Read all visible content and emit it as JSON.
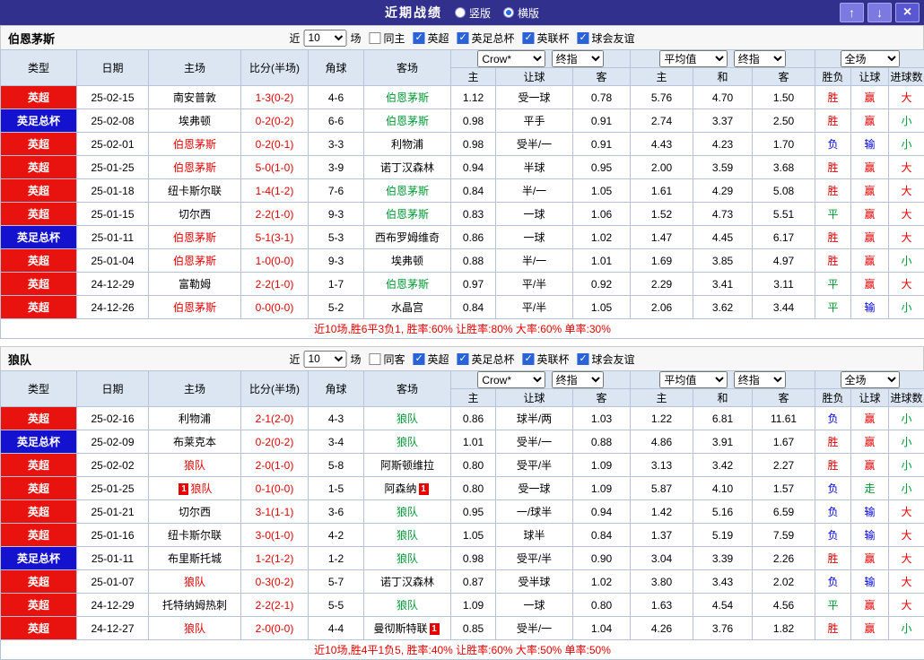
{
  "topbar": {
    "title": "近期战绩",
    "radios": [
      {
        "label": "竖版",
        "checked": false
      },
      {
        "label": "横版",
        "checked": true
      }
    ],
    "up_button": "↑",
    "down_button": "↓",
    "close_button": "×"
  },
  "table_header": {
    "type": "类型",
    "date": "日期",
    "home": "主场",
    "score": "比分(半场)",
    "corner": "角球",
    "away": "客场",
    "odds_source": "Crow*",
    "final_odds": "终指",
    "average": "平均值",
    "scope": "全场",
    "home_odds": "主",
    "handicap": "让球",
    "away_odds": "客",
    "avg_home": "主",
    "avg_draw": "和",
    "avg_away": "客",
    "win_draw_lose": "胜负",
    "handicap_result": "让球",
    "goals_result": "进球数"
  },
  "colors": {
    "league_red": "#e8120e",
    "league_blue": "#1412cf",
    "win_red": "#e60000",
    "draw_green": "#009933",
    "lose_blue": "#0000e6"
  },
  "sections": [
    {
      "team": "伯恩茅斯",
      "filters": {
        "near": "近",
        "count": "10",
        "games": "场",
        "same": {
          "label": "同主",
          "checked": false
        },
        "leagues": [
          {
            "label": "英超",
            "checked": true
          },
          {
            "label": "英足总杯",
            "checked": true
          },
          {
            "label": "英联杯",
            "checked": true
          },
          {
            "label": "球会友谊",
            "checked": true
          }
        ]
      },
      "rows": [
        {
          "league": "英超",
          "lcls": "red",
          "date": "25-02-15",
          "home": "南安普敦",
          "hcls": "",
          "hcard": "",
          "score": "1-3(0-2)",
          "corner": "4-6",
          "away": "伯恩茅斯",
          "acls": "green",
          "acard": "",
          "odds": [
            "1.12",
            "受一球",
            "0.78",
            "5.76",
            "4.70",
            "1.50"
          ],
          "res": [
            [
              "胜",
              "red"
            ],
            [
              "赢",
              "red"
            ],
            [
              "大",
              "red"
            ]
          ]
        },
        {
          "league": "英足总杯",
          "lcls": "blue",
          "date": "25-02-08",
          "home": "埃弗顿",
          "hcls": "",
          "hcard": "",
          "score": "0-2(0-2)",
          "corner": "6-6",
          "away": "伯恩茅斯",
          "acls": "green",
          "acard": "",
          "odds": [
            "0.98",
            "平手",
            "0.91",
            "2.74",
            "3.37",
            "2.50"
          ],
          "res": [
            [
              "胜",
              "red"
            ],
            [
              "赢",
              "red"
            ],
            [
              "小",
              "green"
            ]
          ]
        },
        {
          "league": "英超",
          "lcls": "red",
          "date": "25-02-01",
          "home": "伯恩茅斯",
          "hcls": "red",
          "hcard": "",
          "score": "0-2(0-1)",
          "corner": "3-3",
          "away": "利物浦",
          "acls": "",
          "acard": "",
          "odds": [
            "0.98",
            "受半/一",
            "0.91",
            "4.43",
            "4.23",
            "1.70"
          ],
          "res": [
            [
              "负",
              "blue"
            ],
            [
              "输",
              "blue"
            ],
            [
              "小",
              "green"
            ]
          ]
        },
        {
          "league": "英超",
          "lcls": "red",
          "date": "25-01-25",
          "home": "伯恩茅斯",
          "hcls": "red",
          "hcard": "",
          "score": "5-0(1-0)",
          "corner": "3-9",
          "away": "诺丁汉森林",
          "acls": "",
          "acard": "",
          "odds": [
            "0.94",
            "半球",
            "0.95",
            "2.00",
            "3.59",
            "3.68"
          ],
          "res": [
            [
              "胜",
              "red"
            ],
            [
              "赢",
              "red"
            ],
            [
              "大",
              "red"
            ]
          ]
        },
        {
          "league": "英超",
          "lcls": "red",
          "date": "25-01-18",
          "home": "纽卡斯尔联",
          "hcls": "",
          "hcard": "",
          "score": "1-4(1-2)",
          "corner": "7-6",
          "away": "伯恩茅斯",
          "acls": "green",
          "acard": "",
          "odds": [
            "0.84",
            "半/一",
            "1.05",
            "1.61",
            "4.29",
            "5.08"
          ],
          "res": [
            [
              "胜",
              "red"
            ],
            [
              "赢",
              "red"
            ],
            [
              "大",
              "red"
            ]
          ]
        },
        {
          "league": "英超",
          "lcls": "red",
          "date": "25-01-15",
          "home": "切尔西",
          "hcls": "",
          "hcard": "",
          "score": "2-2(1-0)",
          "corner": "9-3",
          "away": "伯恩茅斯",
          "acls": "green",
          "acard": "",
          "odds": [
            "0.83",
            "一球",
            "1.06",
            "1.52",
            "4.73",
            "5.51"
          ],
          "res": [
            [
              "平",
              "green"
            ],
            [
              "赢",
              "red"
            ],
            [
              "大",
              "red"
            ]
          ]
        },
        {
          "league": "英足总杯",
          "lcls": "blue",
          "date": "25-01-11",
          "home": "伯恩茅斯",
          "hcls": "red",
          "hcard": "",
          "score": "5-1(3-1)",
          "corner": "5-3",
          "away": "西布罗姆维奇",
          "acls": "",
          "acard": "",
          "odds": [
            "0.86",
            "一球",
            "1.02",
            "1.47",
            "4.45",
            "6.17"
          ],
          "res": [
            [
              "胜",
              "red"
            ],
            [
              "赢",
              "red"
            ],
            [
              "大",
              "red"
            ]
          ]
        },
        {
          "league": "英超",
          "lcls": "red",
          "date": "25-01-04",
          "home": "伯恩茅斯",
          "hcls": "red",
          "hcard": "",
          "score": "1-0(0-0)",
          "corner": "9-3",
          "away": "埃弗顿",
          "acls": "",
          "acard": "",
          "odds": [
            "0.88",
            "半/一",
            "1.01",
            "1.69",
            "3.85",
            "4.97"
          ],
          "res": [
            [
              "胜",
              "red"
            ],
            [
              "赢",
              "red"
            ],
            [
              "小",
              "green"
            ]
          ]
        },
        {
          "league": "英超",
          "lcls": "red",
          "date": "24-12-29",
          "home": "富勒姆",
          "hcls": "",
          "hcard": "",
          "score": "2-2(1-0)",
          "corner": "1-7",
          "away": "伯恩茅斯",
          "acls": "green",
          "acard": "",
          "odds": [
            "0.97",
            "平/半",
            "0.92",
            "2.29",
            "3.41",
            "3.11"
          ],
          "res": [
            [
              "平",
              "green"
            ],
            [
              "赢",
              "red"
            ],
            [
              "大",
              "red"
            ]
          ]
        },
        {
          "league": "英超",
          "lcls": "red",
          "date": "24-12-26",
          "home": "伯恩茅斯",
          "hcls": "red",
          "hcard": "",
          "score": "0-0(0-0)",
          "corner": "5-2",
          "away": "水晶宫",
          "acls": "",
          "acard": "",
          "odds": [
            "0.84",
            "平/半",
            "1.05",
            "2.06",
            "3.62",
            "3.44"
          ],
          "res": [
            [
              "平",
              "green"
            ],
            [
              "输",
              "blue"
            ],
            [
              "小",
              "green"
            ]
          ]
        }
      ],
      "summary": "近10场,胜6平3负1, 胜率:60% 让胜率:80% 大率:60% 单率:30%"
    },
    {
      "team": "狼队",
      "filters": {
        "near": "近",
        "count": "10",
        "games": "场",
        "same": {
          "label": "同客",
          "checked": false
        },
        "leagues": [
          {
            "label": "英超",
            "checked": true
          },
          {
            "label": "英足总杯",
            "checked": true
          },
          {
            "label": "英联杯",
            "checked": true
          },
          {
            "label": "球会友谊",
            "checked": true
          }
        ]
      },
      "rows": [
        {
          "league": "英超",
          "lcls": "red",
          "date": "25-02-16",
          "home": "利物浦",
          "hcls": "",
          "hcard": "",
          "score": "2-1(2-0)",
          "corner": "4-3",
          "away": "狼队",
          "acls": "green",
          "acard": "",
          "odds": [
            "0.86",
            "球半/两",
            "1.03",
            "1.22",
            "6.81",
            "11.61"
          ],
          "res": [
            [
              "负",
              "blue"
            ],
            [
              "赢",
              "red"
            ],
            [
              "小",
              "green"
            ]
          ]
        },
        {
          "league": "英足总杯",
          "lcls": "blue",
          "date": "25-02-09",
          "home": "布莱克本",
          "hcls": "",
          "hcard": "",
          "score": "0-2(0-2)",
          "corner": "3-4",
          "away": "狼队",
          "acls": "green",
          "acard": "",
          "odds": [
            "1.01",
            "受半/一",
            "0.88",
            "4.86",
            "3.91",
            "1.67"
          ],
          "res": [
            [
              "胜",
              "red"
            ],
            [
              "赢",
              "red"
            ],
            [
              "小",
              "green"
            ]
          ]
        },
        {
          "league": "英超",
          "lcls": "red",
          "date": "25-02-02",
          "home": "狼队",
          "hcls": "red",
          "hcard": "",
          "score": "2-0(1-0)",
          "corner": "5-8",
          "away": "阿斯顿维拉",
          "acls": "",
          "acard": "",
          "odds": [
            "0.80",
            "受平/半",
            "1.09",
            "3.13",
            "3.42",
            "2.27"
          ],
          "res": [
            [
              "胜",
              "red"
            ],
            [
              "赢",
              "red"
            ],
            [
              "小",
              "green"
            ]
          ]
        },
        {
          "league": "英超",
          "lcls": "red",
          "date": "25-01-25",
          "home": "狼队",
          "hcls": "red",
          "hcard": "l",
          "score": "0-1(0-0)",
          "corner": "1-5",
          "away": "阿森纳",
          "acls": "",
          "acard": "r",
          "odds": [
            "0.80",
            "受一球",
            "1.09",
            "5.87",
            "4.10",
            "1.57"
          ],
          "res": [
            [
              "负",
              "blue"
            ],
            [
              "走",
              "green"
            ],
            [
              "小",
              "green"
            ]
          ]
        },
        {
          "league": "英超",
          "lcls": "red",
          "date": "25-01-21",
          "home": "切尔西",
          "hcls": "",
          "hcard": "",
          "score": "3-1(1-1)",
          "corner": "3-6",
          "away": "狼队",
          "acls": "green",
          "acard": "",
          "odds": [
            "0.95",
            "一/球半",
            "0.94",
            "1.42",
            "5.16",
            "6.59"
          ],
          "res": [
            [
              "负",
              "blue"
            ],
            [
              "输",
              "blue"
            ],
            [
              "大",
              "red"
            ]
          ]
        },
        {
          "league": "英超",
          "lcls": "red",
          "date": "25-01-16",
          "home": "纽卡斯尔联",
          "hcls": "",
          "hcard": "",
          "score": "3-0(1-0)",
          "corner": "4-2",
          "away": "狼队",
          "acls": "green",
          "acard": "",
          "odds": [
            "1.05",
            "球半",
            "0.84",
            "1.37",
            "5.19",
            "7.59"
          ],
          "res": [
            [
              "负",
              "blue"
            ],
            [
              "输",
              "blue"
            ],
            [
              "大",
              "red"
            ]
          ]
        },
        {
          "league": "英足总杯",
          "lcls": "blue",
          "date": "25-01-11",
          "home": "布里斯托城",
          "hcls": "",
          "hcard": "",
          "score": "1-2(1-2)",
          "corner": "1-2",
          "away": "狼队",
          "acls": "green",
          "acard": "",
          "odds": [
            "0.98",
            "受平/半",
            "0.90",
            "3.04",
            "3.39",
            "2.26"
          ],
          "res": [
            [
              "胜",
              "red"
            ],
            [
              "赢",
              "red"
            ],
            [
              "大",
              "red"
            ]
          ]
        },
        {
          "league": "英超",
          "lcls": "red",
          "date": "25-01-07",
          "home": "狼队",
          "hcls": "red",
          "hcard": "",
          "score": "0-3(0-2)",
          "corner": "5-7",
          "away": "诺丁汉森林",
          "acls": "",
          "acard": "",
          "odds": [
            "0.87",
            "受半球",
            "1.02",
            "3.80",
            "3.43",
            "2.02"
          ],
          "res": [
            [
              "负",
              "blue"
            ],
            [
              "输",
              "blue"
            ],
            [
              "大",
              "red"
            ]
          ]
        },
        {
          "league": "英超",
          "lcls": "red",
          "date": "24-12-29",
          "home": "托特纳姆热刺",
          "hcls": "",
          "hcard": "",
          "score": "2-2(2-1)",
          "corner": "5-5",
          "away": "狼队",
          "acls": "green",
          "acard": "",
          "odds": [
            "1.09",
            "一球",
            "0.80",
            "1.63",
            "4.54",
            "4.56"
          ],
          "res": [
            [
              "平",
              "green"
            ],
            [
              "赢",
              "red"
            ],
            [
              "大",
              "red"
            ]
          ]
        },
        {
          "league": "英超",
          "lcls": "red",
          "date": "24-12-27",
          "home": "狼队",
          "hcls": "red",
          "hcard": "",
          "score": "2-0(0-0)",
          "corner": "4-4",
          "away": "曼彻斯特联",
          "acls": "",
          "acard": "r",
          "odds": [
            "0.85",
            "受半/一",
            "1.04",
            "4.26",
            "3.76",
            "1.82"
          ],
          "res": [
            [
              "胜",
              "red"
            ],
            [
              "赢",
              "red"
            ],
            [
              "小",
              "green"
            ]
          ]
        }
      ],
      "summary": "近10场,胜4平1负5, 胜率:40% 让胜率:60% 大率:50% 单率:50%"
    }
  ]
}
